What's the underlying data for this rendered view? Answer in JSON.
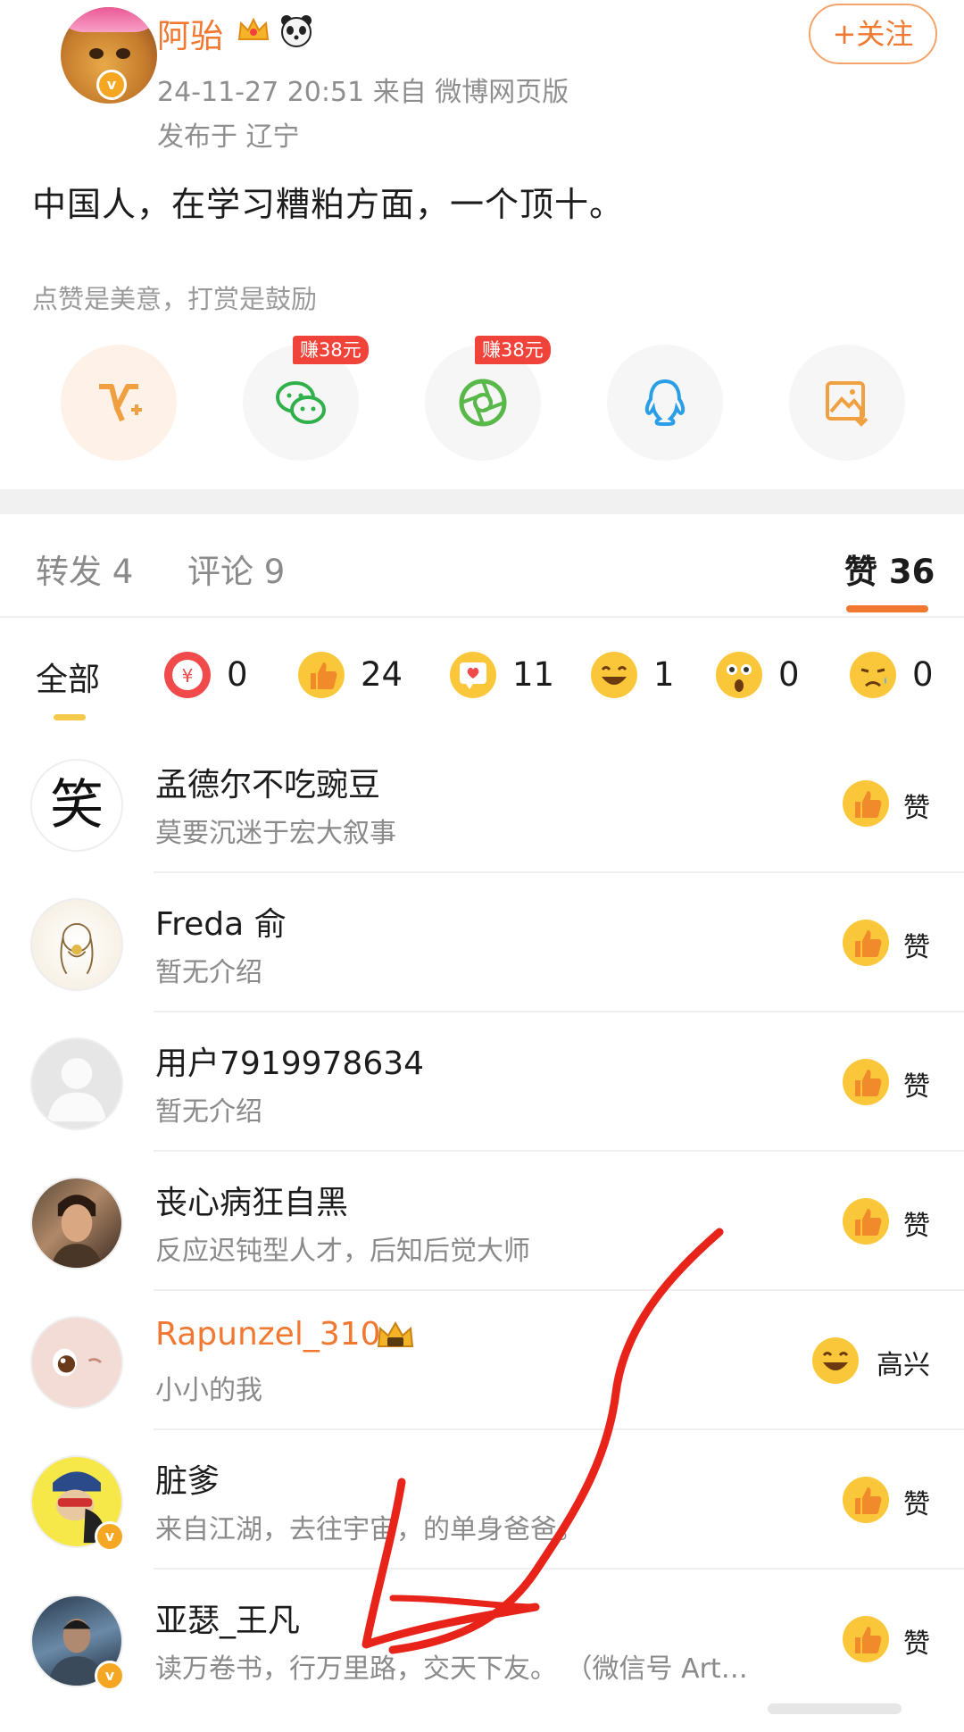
{
  "post": {
    "author": "阿骀",
    "follow_label": "+关注",
    "meta": "24-11-27 20:51  来自 微博网页版",
    "location": "发布于 辽宁",
    "text": "中国人，在学习糟粕方面，一个顶十。",
    "reward_hint": "点赞是美意，打赏是鼓励",
    "share_items": [
      {
        "icon": "vip-icon",
        "badge": ""
      },
      {
        "icon": "wechat-icon",
        "badge": "赚38元"
      },
      {
        "icon": "moments-icon",
        "badge": "赚38元"
      },
      {
        "icon": "qq-icon",
        "badge": ""
      },
      {
        "icon": "save-image-icon",
        "badge": ""
      }
    ]
  },
  "tabs": {
    "repost": "转发 4",
    "comment": "评论 9",
    "like": "赞 36"
  },
  "filters": {
    "all": "全部",
    "items": [
      {
        "icon": "red-envelope-icon",
        "count": "0"
      },
      {
        "icon": "thumbs-up-icon",
        "count": "24"
      },
      {
        "icon": "heart-icon",
        "count": "11"
      },
      {
        "icon": "laugh-icon",
        "count": "1"
      },
      {
        "icon": "surprised-icon",
        "count": "0"
      },
      {
        "icon": "sad-icon",
        "count": "0"
      }
    ]
  },
  "likes": [
    {
      "name": "孟德尔不吃豌豆",
      "desc": "莫要沉迷于宏大叙事",
      "reaction": "赞",
      "avatar_char": "笑"
    },
    {
      "name": "Freda 俞",
      "desc": "暂无介绍",
      "reaction": "赞"
    },
    {
      "name": "用户7919978634",
      "desc": "暂无介绍",
      "reaction": "赞"
    },
    {
      "name": "丧心病狂自黑",
      "desc": "反应迟钝型人才，后知后觉大师",
      "reaction": "赞"
    },
    {
      "name": "Rapunzel_310",
      "desc": "小小的我",
      "reaction": "高兴"
    },
    {
      "name": "脏爹",
      "desc": "来自江湖，去往宇宙，的单身爸爸。",
      "reaction": "赞"
    },
    {
      "name": "亚瑟_王凡",
      "desc": "读万卷书，行万里路，交天下友。 （微信号 Art…",
      "reaction": "赞"
    }
  ],
  "colors": {
    "accent": "#f07830",
    "annotation": "#e8231a",
    "badge_red": "#f0443a"
  }
}
